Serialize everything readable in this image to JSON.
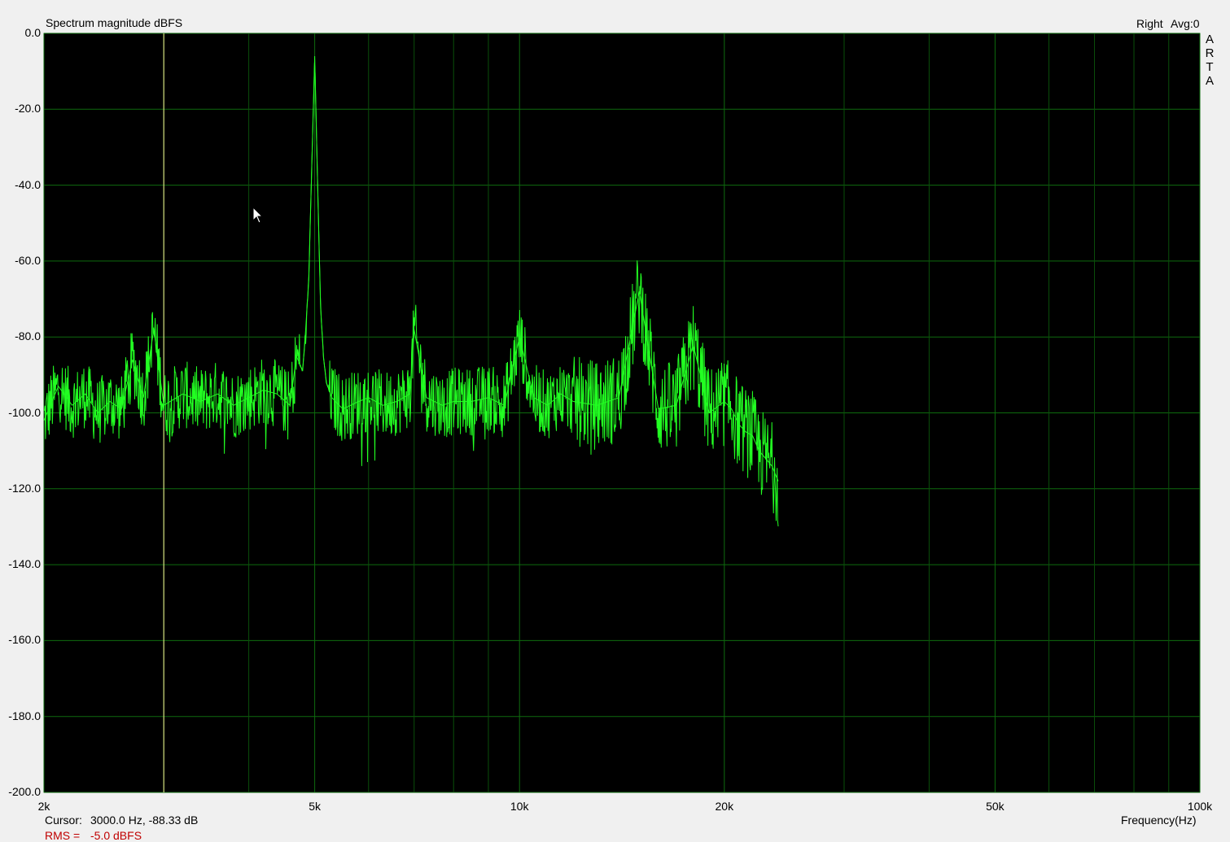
{
  "header": {
    "title": "Spectrum magnitude dBFS",
    "channel": "Right",
    "avg": "Avg:0"
  },
  "brand_letters": [
    "A",
    "R",
    "T",
    "A"
  ],
  "footer": {
    "cursor_label": "Cursor:",
    "cursor_value": "3000.0 Hz, -88.33 dB",
    "rms_label": "RMS =",
    "rms_value": "-5.0 dBFS",
    "xlabel": "Frequency(Hz)"
  },
  "colors": {
    "plot_bg": "#000000",
    "grid": "#0e6b0e",
    "trace": "#22ff22",
    "cursor_line": "#ffff99",
    "rms_text": "#c00000"
  },
  "chart_data": {
    "type": "line",
    "title": "Spectrum magnitude dBFS",
    "xlabel": "Frequency(Hz)",
    "ylabel": "",
    "x_scale": "log",
    "xlim": [
      2000,
      100000
    ],
    "ylim": [
      -200,
      0
    ],
    "grid": true,
    "y_ticks": [
      0,
      -20,
      -40,
      -60,
      -80,
      -100,
      -120,
      -140,
      -160,
      -180,
      -200
    ],
    "y_tick_labels": [
      "0.0",
      "-20.0",
      "-40.0",
      "-60.0",
      "-80.0",
      "-100.0",
      "-120.0",
      "-140.0",
      "-160.0",
      "-180.0",
      "-200.0"
    ],
    "x_major_ticks": [
      2000,
      5000,
      10000,
      20000,
      50000,
      100000
    ],
    "x_tick_labels": [
      "2k",
      "5k",
      "10k",
      "20k",
      "50k",
      "100k"
    ],
    "x_minor_gridlines": [
      3000,
      4000,
      6000,
      7000,
      8000,
      9000,
      30000,
      40000,
      60000,
      70000,
      80000,
      90000
    ],
    "cursor": {
      "x": 3000,
      "y": -88.33
    },
    "series": [
      {
        "x": [
          2000,
          2100,
          2200,
          2300,
          2400,
          2500,
          2600,
          2700,
          2800,
          2900,
          3000,
          3200,
          3400,
          3600,
          3800,
          4000,
          4200,
          4400,
          4600,
          4700,
          4800,
          4850,
          4900,
          4950,
          5000,
          5050,
          5100,
          5150,
          5200,
          5300,
          5500,
          5800,
          6000,
          6300,
          6600,
          6900,
          7000,
          7300,
          7700,
          8000,
          8500,
          9000,
          9500,
          10000,
          10500,
          11000,
          11500,
          12000,
          13000,
          14000,
          15000,
          16000,
          17000,
          18000,
          19000,
          20000,
          20500,
          21000,
          21500,
          22000,
          22500,
          23000,
          23500,
          24000
        ],
        "y": [
          -102,
          -93,
          -98,
          -95,
          -100,
          -97,
          -99,
          -86,
          -96,
          -78,
          -98,
          -95,
          -97,
          -95,
          -98,
          -96,
          -94,
          -95,
          -98,
          -85,
          -89,
          -78,
          -65,
          -35,
          -6,
          -40,
          -72,
          -85,
          -92,
          -96,
          -99,
          -97,
          -96,
          -98,
          -97,
          -95,
          -78,
          -96,
          -98,
          -97,
          -97,
          -96,
          -98,
          -80,
          -96,
          -98,
          -95,
          -97,
          -98,
          -96,
          -68,
          -99,
          -98,
          -82,
          -100,
          -97,
          -99,
          -103,
          -105,
          -106,
          -110,
          -112,
          -114,
          -118
        ]
      }
    ]
  }
}
